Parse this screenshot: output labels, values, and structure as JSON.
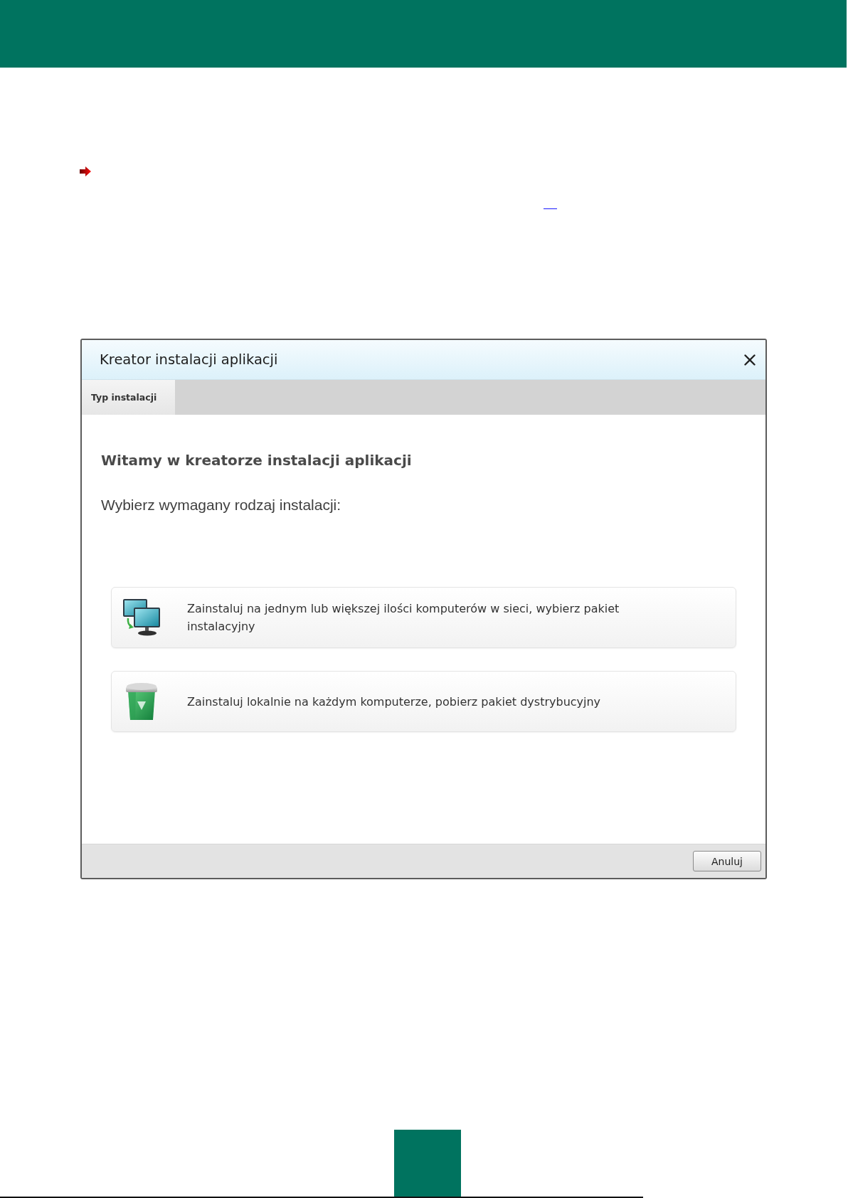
{
  "dialog": {
    "title": "Kreator instalacji aplikacji",
    "tabs": [
      {
        "label": "Typ instalacji",
        "selected": true
      }
    ],
    "heading": "Witamy w kreatorze instalacji aplikacji",
    "prompt": "Wybierz wymagany rodzaj instalacji:",
    "options": [
      {
        "kind": "network",
        "text": "Zainstaluj na jednym lub większej ilości komputerów w sieci, wybierz pakiet instalacyjny"
      },
      {
        "kind": "local",
        "text": "Zainstaluj lokalnie na każdym komputerze, pobierz pakiet dystrybucyjny"
      }
    ],
    "buttons": [
      "Anuluj"
    ]
  }
}
